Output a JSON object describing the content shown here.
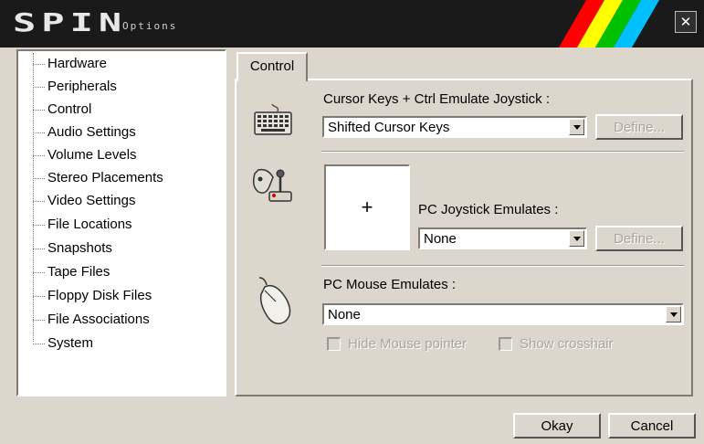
{
  "window": {
    "logo_text": "SPIN",
    "logo_subtitle": "Options",
    "close_glyph": "✕",
    "stripe_colors": [
      "#ff0000",
      "#ffff00",
      "#00c000",
      "#00c0ff"
    ]
  },
  "sidebar": {
    "items": [
      {
        "label": "Hardware"
      },
      {
        "label": "Peripherals"
      },
      {
        "label": "Control"
      },
      {
        "label": "Audio Settings"
      },
      {
        "label": "Volume Levels"
      },
      {
        "label": "Stereo Placements"
      },
      {
        "label": "Video Settings"
      },
      {
        "label": "File Locations"
      },
      {
        "label": "Snapshots"
      },
      {
        "label": "Tape Files"
      },
      {
        "label": "Floppy Disk Files"
      },
      {
        "label": "File Associations"
      },
      {
        "label": "System"
      }
    ]
  },
  "tabs": [
    {
      "label": "Control"
    }
  ],
  "cursor_keys": {
    "icon": "keyboard-icon",
    "label": "Cursor Keys + Ctrl Emulate Joystick :",
    "value": "Shifted Cursor Keys",
    "define_label": "Define..."
  },
  "pc_joystick": {
    "icon": "joystick-icon",
    "preview_glyph": "+",
    "label": "PC Joystick Emulates :",
    "value": "None",
    "define_label": "Define..."
  },
  "pc_mouse": {
    "icon": "mouse-icon",
    "label": "PC Mouse Emulates :",
    "value": "None",
    "hide_pointer_label": "Hide Mouse pointer",
    "show_crosshair_label": "Show crosshair"
  },
  "footer": {
    "okay_label": "Okay",
    "cancel_label": "Cancel"
  }
}
